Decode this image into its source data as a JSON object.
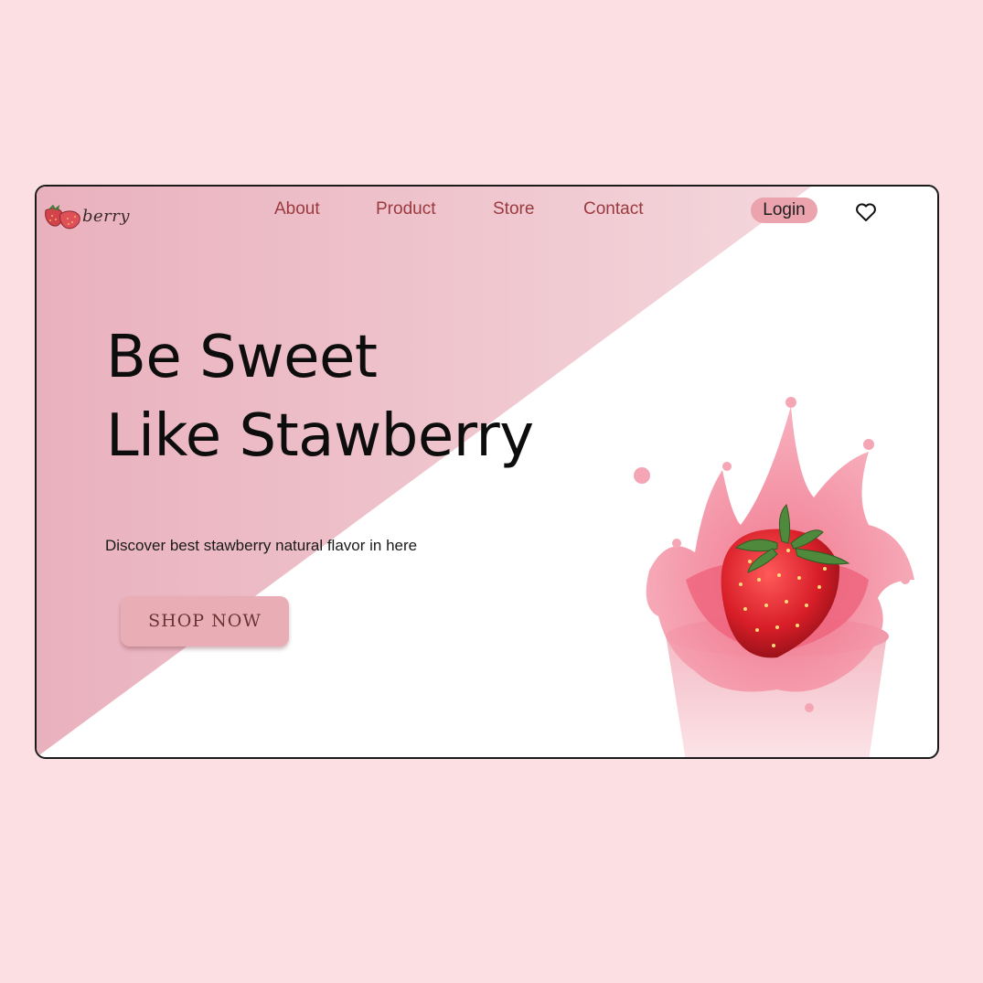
{
  "header": {
    "logo_text": "berry",
    "nav": [
      "About",
      "Product",
      "Store",
      "Contact"
    ],
    "login_label": "Login"
  },
  "hero": {
    "title_line1": "Be Sweet",
    "title_line2": "Like Stawberry",
    "subtitle": "Discover best stawberry natural flavor in here",
    "cta_label": "SHOP NOW"
  },
  "icons": {
    "logo": "strawberry-icon",
    "wishlist": "heart-icon",
    "hero_image": "strawberry-milk-splash"
  },
  "colors": {
    "page_background": "#fbdfe3",
    "nav_text": "#9a3a3e",
    "login_bg": "#eba4ad",
    "cta_bg": "#e9aeb5",
    "cta_text": "#6a3535"
  }
}
